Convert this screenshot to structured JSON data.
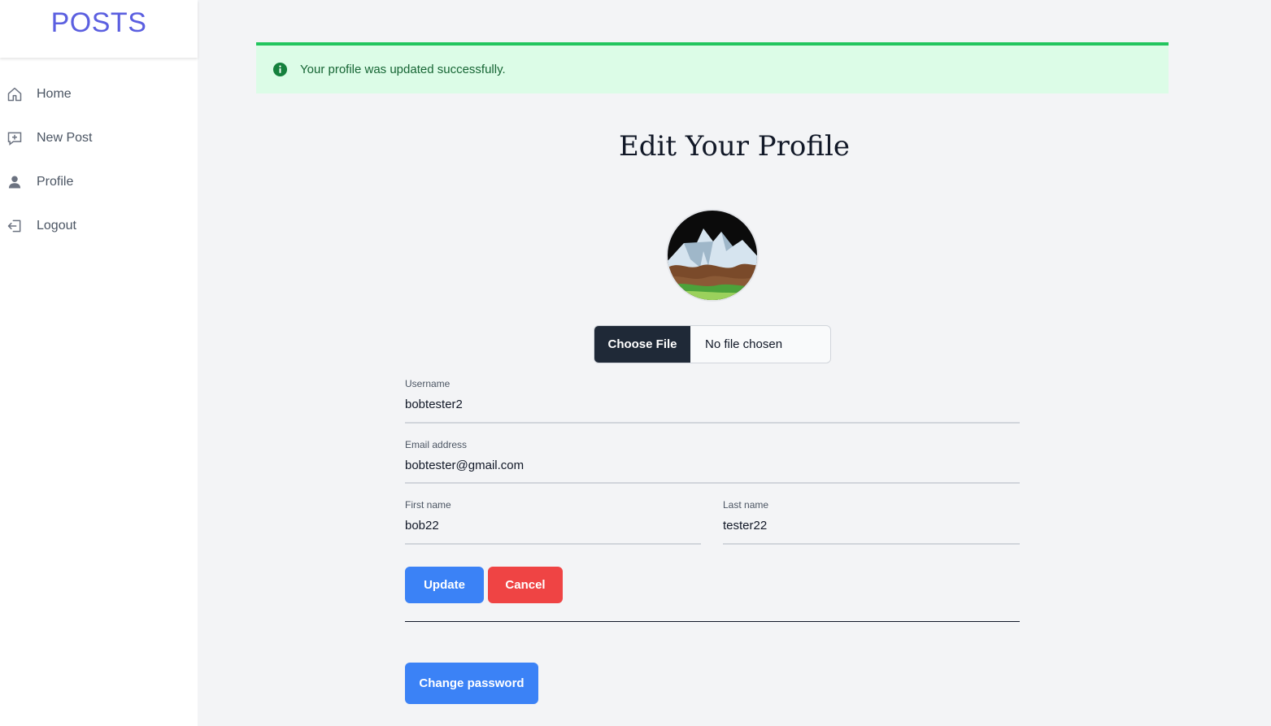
{
  "sidebar": {
    "brand": "POSTS",
    "items": [
      {
        "label": "Home",
        "icon": "home-icon"
      },
      {
        "label": "New Post",
        "icon": "plus-square-icon"
      },
      {
        "label": "Profile",
        "icon": "user-icon"
      },
      {
        "label": "Logout",
        "icon": "logout-icon"
      }
    ]
  },
  "alert": {
    "message": "Your profile was updated successfully.",
    "icon": "info-icon",
    "color": "#22c55e"
  },
  "page": {
    "title": "Edit Your Profile"
  },
  "file_input": {
    "button_label": "Choose File",
    "status": "No file chosen"
  },
  "form": {
    "username": {
      "label": "Username",
      "value": "bobtester2"
    },
    "email": {
      "label": "Email address",
      "value": "bobtester@gmail.com"
    },
    "first_name": {
      "label": "First name",
      "value": "bob22"
    },
    "last_name": {
      "label": "Last name",
      "value": "tester22"
    }
  },
  "actions": {
    "update_label": "Update",
    "cancel_label": "Cancel",
    "change_password_label": "Change password"
  },
  "colors": {
    "primary": "#3b82f6",
    "danger": "#ef4444",
    "brand": "#5b5fe0"
  }
}
